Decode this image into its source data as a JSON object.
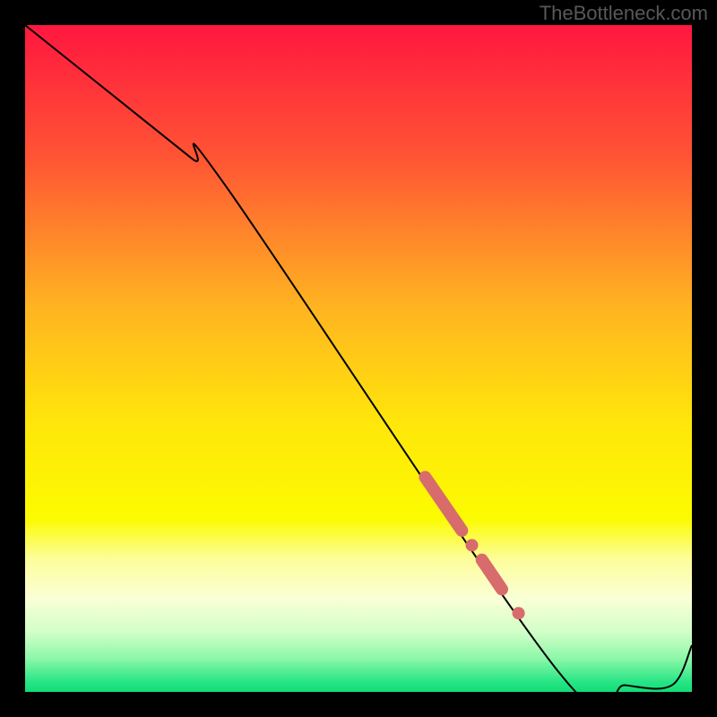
{
  "watermark": "TheBottleneck.com",
  "chart_data": {
    "type": "line",
    "title": "",
    "xlabel": "",
    "ylabel": "",
    "xlim": [
      0,
      100
    ],
    "ylim": [
      0,
      100
    ],
    "grid": false,
    "series": [
      {
        "name": "curve",
        "x": [
          0,
          10,
          25,
          30,
          80,
          90,
          97,
          100
        ],
        "y": [
          100,
          92,
          80,
          76,
          3,
          1,
          1,
          7
        ]
      }
    ],
    "markers": [
      {
        "name": "cluster-a-start",
        "x": 60.0,
        "y": 32.2
      },
      {
        "name": "cluster-a-end",
        "x": 65.5,
        "y": 24.2
      },
      {
        "name": "gap-point-1",
        "x": 67.0,
        "y": 22.0
      },
      {
        "name": "cluster-b-start",
        "x": 68.5,
        "y": 19.8
      },
      {
        "name": "cluster-b-end",
        "x": 71.5,
        "y": 15.4
      },
      {
        "name": "lone-point",
        "x": 74.0,
        "y": 11.8
      }
    ],
    "gradient_stops": [
      {
        "pos": 0.0,
        "color": "#ff173f"
      },
      {
        "pos": 0.2,
        "color": "#ff5534"
      },
      {
        "pos": 0.42,
        "color": "#ffb321"
      },
      {
        "pos": 0.6,
        "color": "#ffe70a"
      },
      {
        "pos": 0.74,
        "color": "#fbfb00"
      },
      {
        "pos": 0.8,
        "color": "#fdfd9a"
      },
      {
        "pos": 0.86,
        "color": "#faffd6"
      },
      {
        "pos": 0.91,
        "color": "#d2ffc8"
      },
      {
        "pos": 0.95,
        "color": "#8cf7a8"
      },
      {
        "pos": 0.985,
        "color": "#27e585"
      },
      {
        "pos": 1.0,
        "color": "#10dd78"
      }
    ],
    "line_color": "#000000",
    "marker_color": "#d86b6b",
    "marker_radius": 7
  }
}
